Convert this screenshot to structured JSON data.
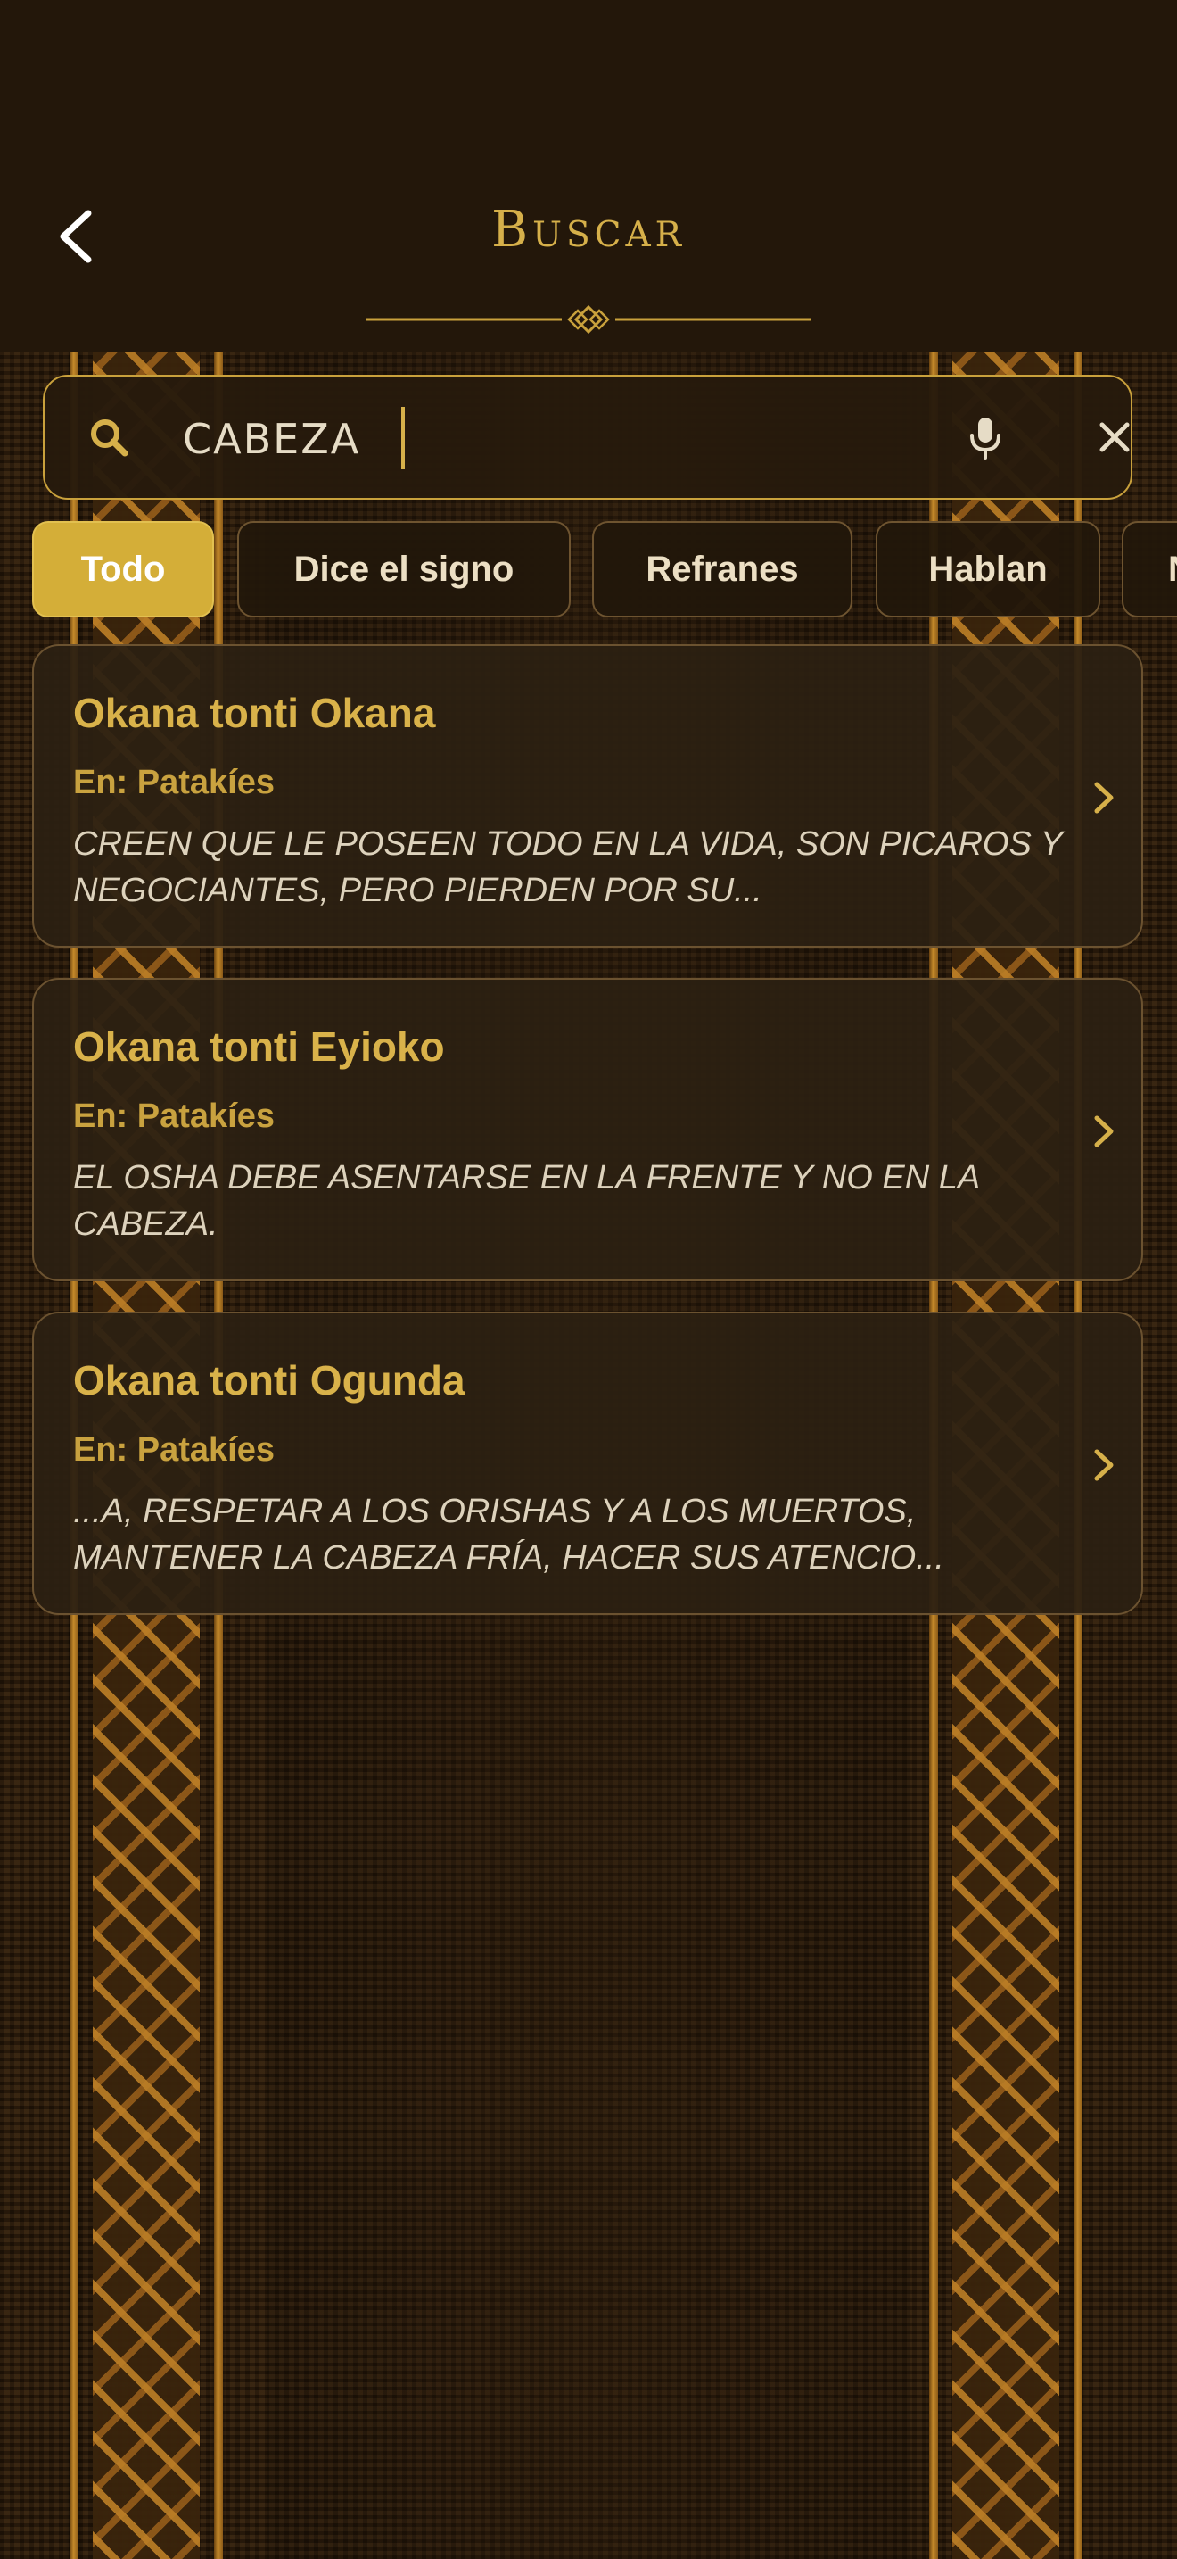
{
  "colors": {
    "accent": "#d4ae38",
    "title_gold": "#d9b24a",
    "header_bg": "#23170a",
    "card_bg": "#2c2012",
    "text_light": "#ddd2bc"
  },
  "header": {
    "title": "Buscar",
    "back_icon": "chevron-left-icon",
    "ornament_icon": "divider-ornament-icon"
  },
  "search": {
    "value": "CABEZA",
    "placeholder": "",
    "search_icon": "search-icon",
    "mic_icon": "microphone-icon",
    "clear_icon": "close-icon"
  },
  "filters": [
    {
      "label": "Todo",
      "active": true
    },
    {
      "label": "Dice el signo",
      "active": false
    },
    {
      "label": "Refranes",
      "active": false
    },
    {
      "label": "Hablan",
      "active": false
    },
    {
      "label": "N",
      "active": false
    }
  ],
  "results": [
    {
      "title": "Okana tonti Okana",
      "source": "En: Patakíes",
      "snippet": "Creen que le poseen todo en la vida, son picaros y negociantes, pero pierden por su..."
    },
    {
      "title": "Okana tonti Eyioko",
      "source": "En: Patakíes",
      "snippet": "El osha debe asentarse en la frente y no en la cabeza."
    },
    {
      "title": "Okana tonti Ogunda",
      "source": "En: Patakíes",
      "snippet": "...a, respetar a los orishas y a los muertos, mantener la cabeza fría, hacer sus atencio..."
    }
  ]
}
